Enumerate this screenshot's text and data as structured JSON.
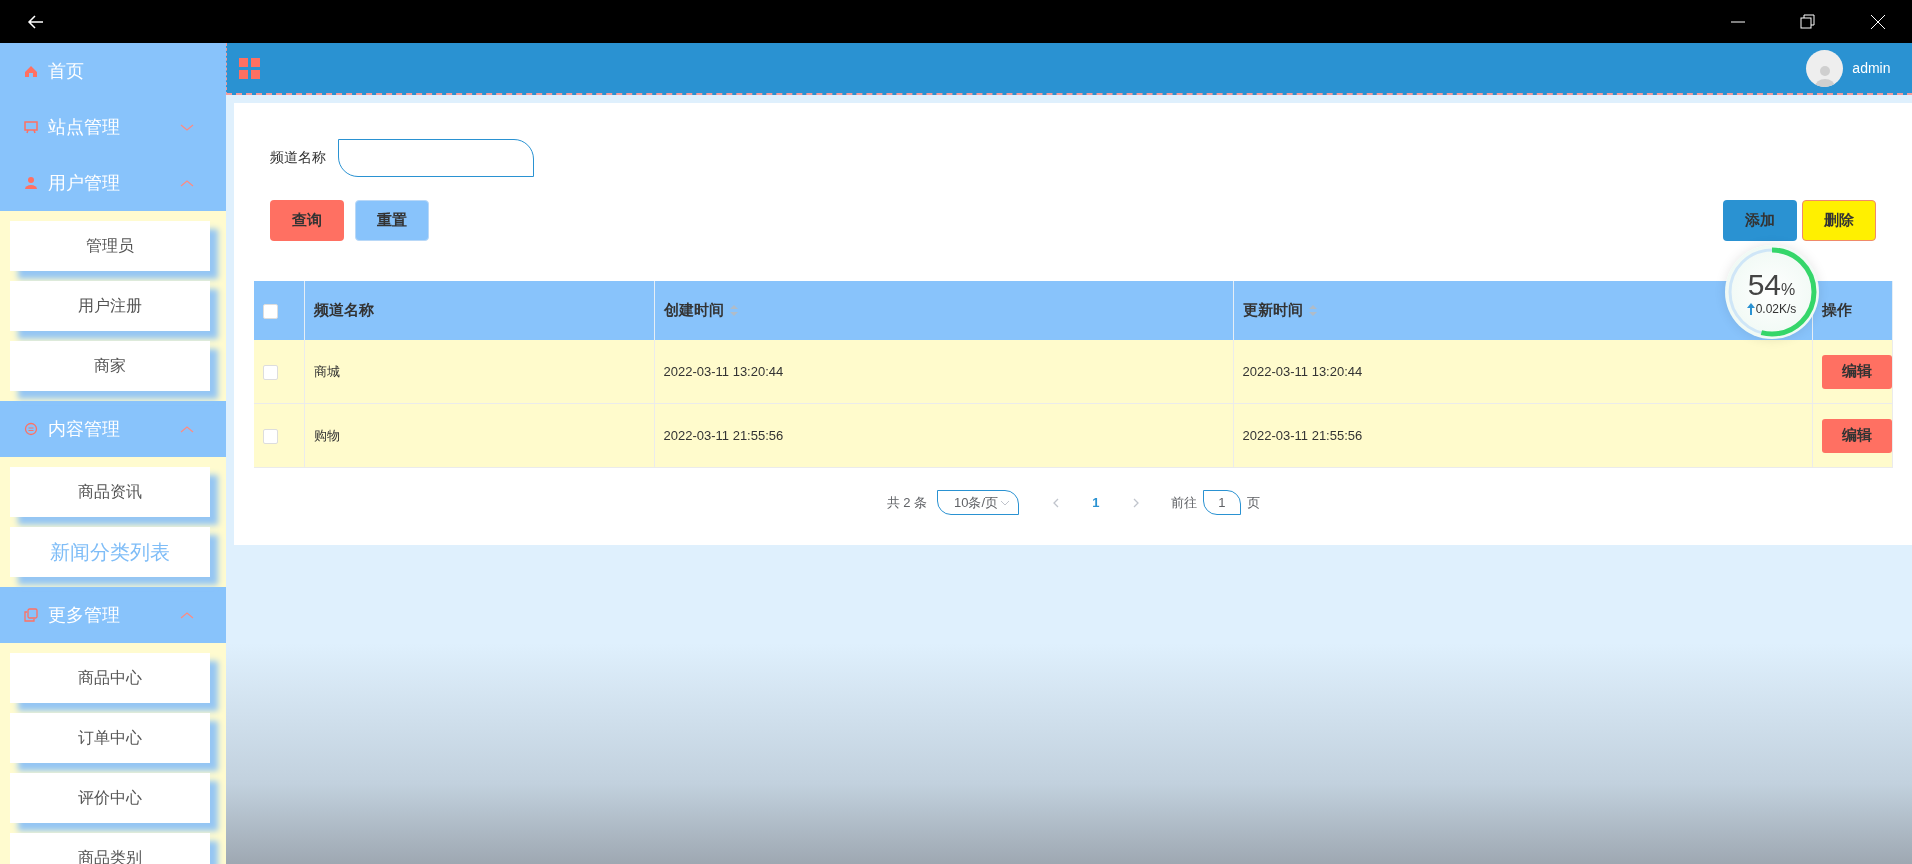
{
  "sidebar": {
    "items": [
      {
        "label": "首页"
      },
      {
        "label": "站点管理",
        "expanded": false
      },
      {
        "label": "用户管理",
        "expanded": true,
        "children": [
          {
            "label": "管理员",
            "selected": false
          },
          {
            "label": "用户注册",
            "selected": false
          },
          {
            "label": "商家",
            "selected": false
          }
        ]
      },
      {
        "label": "内容管理",
        "expanded": true,
        "children": [
          {
            "label": "商品资讯",
            "selected": false
          },
          {
            "label": "新闻分类列表",
            "selected": true
          }
        ]
      },
      {
        "label": "更多管理",
        "expanded": true,
        "children": [
          {
            "label": "商品中心",
            "selected": false
          },
          {
            "label": "订单中心",
            "selected": false
          },
          {
            "label": "评价中心",
            "selected": false
          },
          {
            "label": "商品类别",
            "selected": false
          }
        ]
      }
    ]
  },
  "header": {
    "user": "admin"
  },
  "search": {
    "label": "频道名称"
  },
  "buttons": [
    {
      "label": "查询",
      "kind": "query"
    },
    {
      "label": "重置",
      "kind": "reset"
    }
  ],
  "actions": [
    {
      "label": "添加",
      "kind": "add"
    },
    {
      "label": "删除",
      "kind": "delete"
    }
  ],
  "table": {
    "select_all": {
      "checked": false
    },
    "columns": [
      {
        "label": "频道名称",
        "sortable": false
      },
      {
        "label": "创建时间",
        "sortable": true
      },
      {
        "label": "更新时间",
        "sortable": true
      },
      {
        "label": "操作",
        "sortable": false
      }
    ],
    "rows": [
      {
        "checked": false,
        "cells": [
          "商城",
          "2022-03-11 13:20:44",
          "2022-03-11 13:20:44"
        ],
        "action": "编辑"
      },
      {
        "checked": false,
        "cells": [
          "购物",
          "2022-03-11 21:55:56",
          "2022-03-11 21:55:56"
        ],
        "action": "编辑"
      }
    ]
  },
  "pagination": {
    "total": "共 2 条",
    "page_size": "10条/页",
    "pages": [
      {
        "label": "1",
        "selected": true
      }
    ],
    "goto_label": "前往",
    "goto_value": "1",
    "goto_suffix": "页"
  },
  "speed_monitor": {
    "percent": "54",
    "unit": "%",
    "rate": "0.02K/s",
    "level": 0.54
  }
}
